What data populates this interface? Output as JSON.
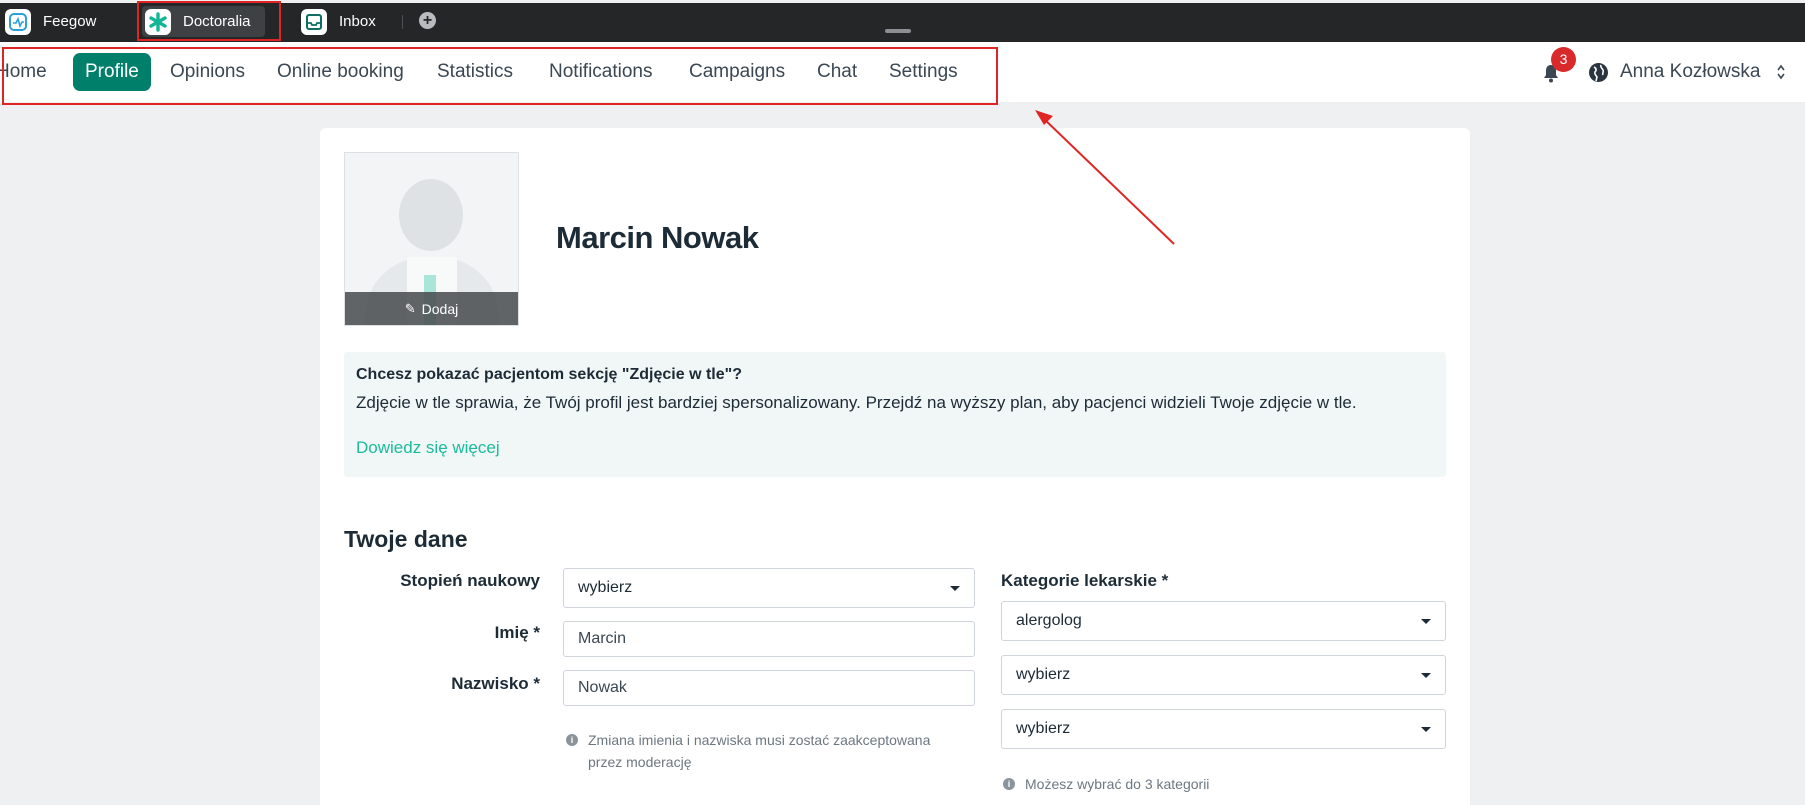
{
  "app_bar": {
    "tabs": [
      {
        "label": "Feegow",
        "icon": "feegow-logo-icon"
      },
      {
        "label": "Doctoralia",
        "icon": "doctoralia-logo-icon",
        "active": true
      },
      {
        "label": "Inbox",
        "icon": "inbox-icon"
      }
    ],
    "add_tab_icon": "plus-circle-icon"
  },
  "nav": {
    "items": [
      {
        "label": "Home"
      },
      {
        "label": "Profile",
        "active": true
      },
      {
        "label": "Opinions"
      },
      {
        "label": "Online booking"
      },
      {
        "label": "Statistics"
      },
      {
        "label": "Notifications"
      },
      {
        "label": "Campaigns"
      },
      {
        "label": "Chat"
      },
      {
        "label": "Settings"
      }
    ],
    "notification_count": "3",
    "user_name": "Anna Kozłowska"
  },
  "profile": {
    "name": "Marcin Nowak",
    "photo_add_label": "Dodaj"
  },
  "info": {
    "title": "Chcesz pokazać pacjentom sekcję \"Zdjęcie w tle\"?",
    "text": "Zdjęcie w tle sprawia, że Twój profil jest bardziej spersonalizowany. Przejdź na wyższy plan, aby pacjenci widzieli Twoje zdjęcie w tle.",
    "link": "Dowiedz się więcej"
  },
  "form": {
    "section_title": "Twoje dane",
    "degree_label": "Stopień naukowy",
    "degree_value": "wybierz",
    "first_name_label": "Imię *",
    "first_name_value": "Marcin",
    "last_name_label": "Nazwisko *",
    "last_name_value": "Nowak",
    "name_hint": "Zmiana imienia i nazwiska musi zostać zaakceptowana przez moderację",
    "categories_label": "Kategorie lekarskie *",
    "categories": [
      "alergolog",
      "wybierz",
      "wybierz"
    ],
    "categories_hint": "Możesz wybrać do 3 kategorii"
  },
  "colors": {
    "accent": "#00806a",
    "link": "#1abc9c",
    "badge": "#d82a2a",
    "annotation": "#e02424"
  }
}
